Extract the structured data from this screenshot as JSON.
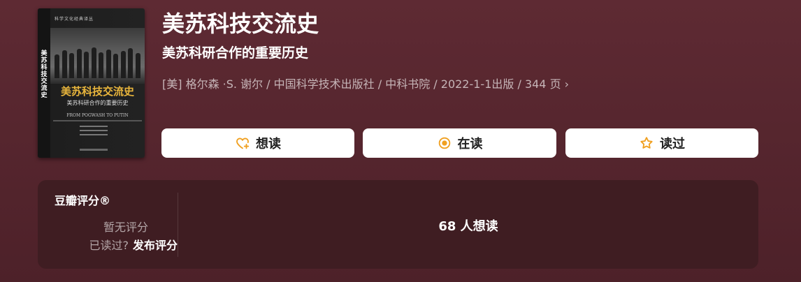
{
  "book": {
    "title": "美苏科技交流史",
    "subtitle": "美苏科研合作的重要历史",
    "meta": "[美] 格尔森 ·S. 谢尔 / 中国科学技术出版社 / 中科书院 / 2022-1-1出版 / 344 页",
    "meta_chevron": "›"
  },
  "cover": {
    "spine_title": "美苏科技交流史",
    "series": "科学文化经典译丛",
    "title": "美苏科技交流史",
    "subtitle": "美苏科研合作的重要历史",
    "english": "FROM POGWASH TO PUTIN"
  },
  "actions": {
    "want": {
      "label": "想读",
      "icon": "heart-plus-icon"
    },
    "reading": {
      "label": "在读",
      "icon": "target-circle-icon"
    },
    "read": {
      "label": "读过",
      "icon": "star-icon"
    }
  },
  "rating": {
    "heading": "豆瓣评分®",
    "no_rating": "暂无评分",
    "read_question": "已读过?",
    "publish_link": "发布评分",
    "want_count_text": "68 人想读"
  },
  "colors": {
    "background": "#5a2830",
    "panel": "#3f1d22",
    "icon_accent": "#f0a020"
  }
}
